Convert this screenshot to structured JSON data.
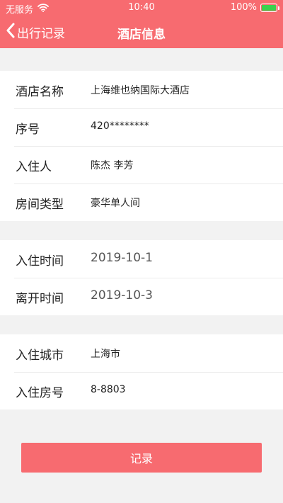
{
  "status_bar": {
    "carrier": "无服务",
    "wifi_icon": "wifi-icon",
    "time": "10:40",
    "battery_percent": "100%",
    "battery_level": 1.0,
    "battery_color": "#3ad14d"
  },
  "nav": {
    "back_label": "出行记录",
    "back_icon": "chevron-left-icon",
    "title": "酒店信息",
    "accent_color": "#f76b70"
  },
  "section1": {
    "rows": [
      {
        "label": "酒店名称",
        "value": "上海维也纳国际大酒店"
      },
      {
        "label": "序号",
        "value": "420********"
      },
      {
        "label": "入住人",
        "value": "陈杰 李芳"
      },
      {
        "label": "房间类型",
        "value": "豪华单人间"
      }
    ]
  },
  "section2": {
    "rows": [
      {
        "label": "入住时间",
        "value": "2019-10-1"
      },
      {
        "label": "离开时间",
        "value": "2019-10-3"
      }
    ]
  },
  "section3": {
    "rows": [
      {
        "label": "入住城市",
        "value": "上海市"
      },
      {
        "label": "入住房号",
        "value": "8-8803"
      }
    ]
  },
  "actions": {
    "record_label": "记录"
  }
}
